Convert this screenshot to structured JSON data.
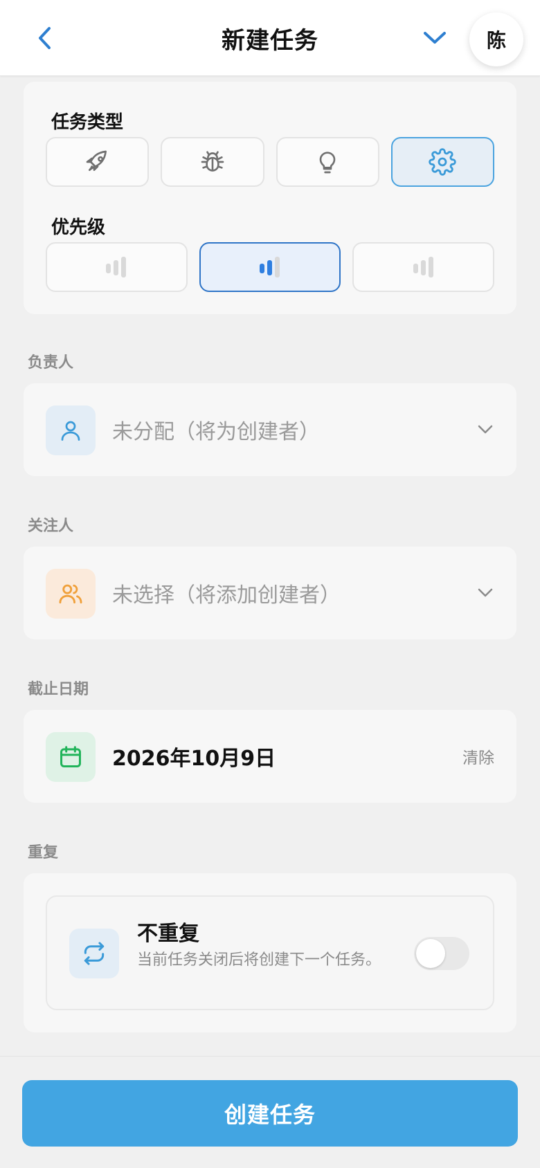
{
  "header": {
    "title": "新建任务",
    "avatar_text": "陈"
  },
  "task_type": {
    "label": "任务类型",
    "options": [
      {
        "icon": "rocket-icon",
        "selected": false
      },
      {
        "icon": "bug-icon",
        "selected": false
      },
      {
        "icon": "lightbulb-icon",
        "selected": false
      },
      {
        "icon": "gear-icon",
        "selected": true
      }
    ]
  },
  "priority": {
    "label": "优先级",
    "options": [
      {
        "icon": "priority-low-icon",
        "selected": false
      },
      {
        "icon": "priority-medium-icon",
        "selected": true
      },
      {
        "icon": "priority-high-icon",
        "selected": false
      }
    ]
  },
  "assignee": {
    "label": "负责人",
    "value": "未分配（将为创建者）",
    "icon": "person-icon"
  },
  "followers": {
    "label": "关注人",
    "value": "未选择（将添加创建者）",
    "icon": "people-icon"
  },
  "due_date": {
    "label": "截止日期",
    "value": "2026年10月9日",
    "clear_label": "清除",
    "icon": "calendar-icon"
  },
  "repeat": {
    "label": "重复",
    "title": "不重复",
    "description": "当前任务关闭后将创建下一个任务。",
    "icon": "repeat-icon",
    "enabled": false
  },
  "footer": {
    "create_label": "创建任务"
  },
  "colors": {
    "accent": "#42a5e2",
    "selected_border": "#4aa3df",
    "priority_selected": "#2e74c7",
    "assignee_icon_bg": "#e3edf6",
    "followers_icon_bg": "#fbeadb",
    "date_icon_bg": "#dff2e6"
  }
}
